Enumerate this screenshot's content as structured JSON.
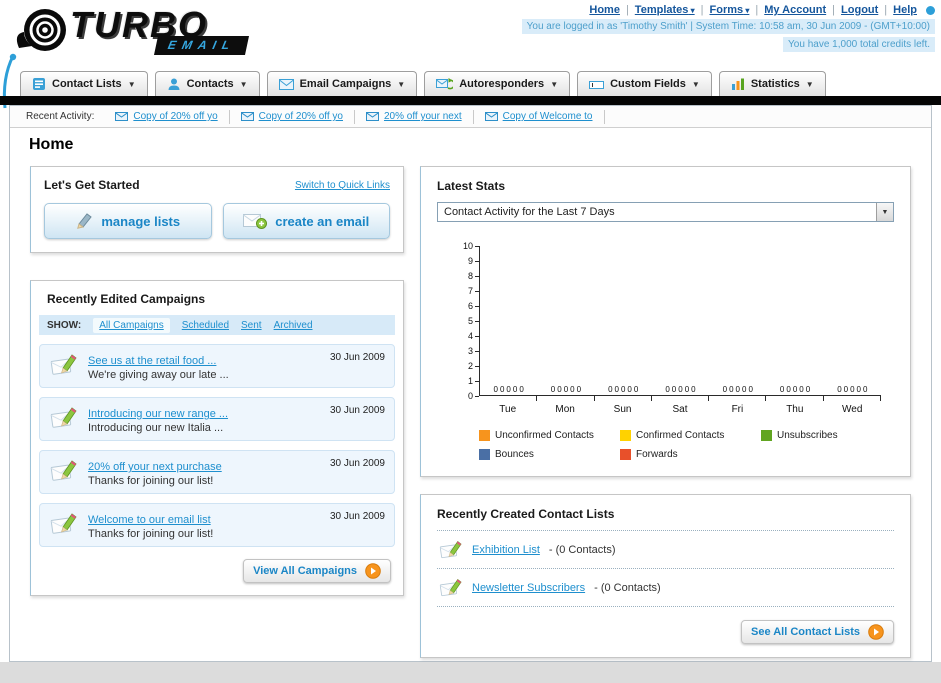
{
  "header": {
    "logo_primary": "TURBO",
    "logo_secondary": "EMAIL",
    "nav": {
      "home": "Home",
      "templates": "Templates",
      "forms": "Forms",
      "my_account": "My Account",
      "logout": "Logout",
      "help": "Help"
    },
    "login_info": "You are logged in as 'Timothy Smith' | System Time: 10:58 am, 30 Jun 2009 - (GMT+10:00)",
    "credits_info": "You have 1,000 total credits left."
  },
  "nav_tabs": [
    {
      "label": "Contact Lists"
    },
    {
      "label": "Contacts"
    },
    {
      "label": "Email Campaigns"
    },
    {
      "label": "Autoresponders"
    },
    {
      "label": "Custom Fields"
    },
    {
      "label": "Statistics"
    }
  ],
  "recent_activity": {
    "label": "Recent Activity:",
    "items": [
      {
        "text": "Copy of 20% off yo"
      },
      {
        "text": "Copy of 20% off yo"
      },
      {
        "text": "20% off your next"
      },
      {
        "text": "Copy of Welcome to"
      }
    ]
  },
  "page": {
    "title": "Home"
  },
  "get_started": {
    "title": "Let's Get Started",
    "switch_link": "Switch to Quick Links",
    "manage_lists_label": "manage lists",
    "create_email_label": "create an email"
  },
  "campaigns": {
    "title": "Recently Edited Campaigns",
    "show_label": "SHOW:",
    "filters": [
      {
        "label": "All Campaigns",
        "selected": true
      },
      {
        "label": "Scheduled",
        "selected": false
      },
      {
        "label": "Sent",
        "selected": false
      },
      {
        "label": "Archived",
        "selected": false
      }
    ],
    "items": [
      {
        "title": "See us at the retail food ...",
        "subtitle": "We're giving away our late ...",
        "date": "30 Jun 2009"
      },
      {
        "title": "Introducing our new range ...",
        "subtitle": "Introducing our new Italia ...",
        "date": "30 Jun 2009"
      },
      {
        "title": "20% off your next purchase",
        "subtitle": "Thanks for joining our list!",
        "date": "30 Jun 2009"
      },
      {
        "title": "Welcome to our email list",
        "subtitle": "Thanks for joining our list!",
        "date": "30 Jun 2009"
      }
    ],
    "view_all_label": "View All Campaigns"
  },
  "stats": {
    "title": "Latest Stats",
    "selected_option": "Contact Activity for the Last 7 Days"
  },
  "chart_data": {
    "type": "bar",
    "title": "Contact Activity for the Last 7 Days",
    "categories": [
      "Tue",
      "Mon",
      "Sun",
      "Sat",
      "Fri",
      "Thu",
      "Wed"
    ],
    "series": [
      {
        "name": "Unconfirmed Contacts",
        "color": "#f7941d",
        "values": [
          0,
          0,
          0,
          0,
          0,
          0,
          0
        ]
      },
      {
        "name": "Confirmed Contacts",
        "color": "#ffd200",
        "values": [
          0,
          0,
          0,
          0,
          0,
          0,
          0
        ]
      },
      {
        "name": "Unsubscribes",
        "color": "#61a521",
        "values": [
          0,
          0,
          0,
          0,
          0,
          0,
          0
        ]
      },
      {
        "name": "Bounces",
        "color": "#4a6fa5",
        "values": [
          0,
          0,
          0,
          0,
          0,
          0,
          0
        ]
      },
      {
        "name": "Forwards",
        "color": "#e8502a",
        "values": [
          0,
          0,
          0,
          0,
          0,
          0,
          0
        ]
      }
    ],
    "ylim": [
      0,
      10
    ],
    "ytick_step": 1,
    "show_value_labels": true,
    "legend_position": "bottom",
    "grid": false
  },
  "contact_lists": {
    "title": "Recently Created Contact Lists",
    "items": [
      {
        "name": "Exhibition List",
        "detail": "- (0 Contacts)"
      },
      {
        "name": "Newsletter Subscribers",
        "detail": "- (0 Contacts)"
      }
    ],
    "see_all_label": "See All Contact Lists"
  }
}
